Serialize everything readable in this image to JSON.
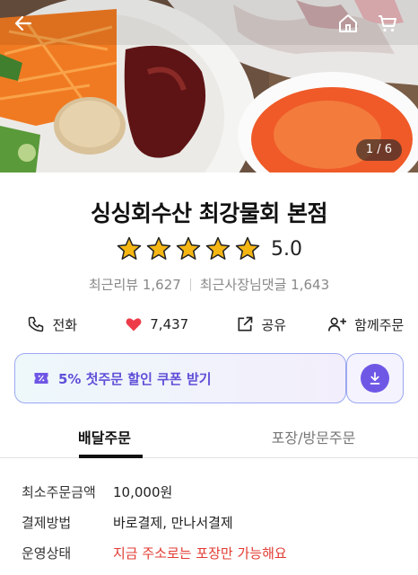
{
  "hero": {
    "counter": "1 / 6",
    "icons": {
      "back": "back-arrow-icon",
      "home": "home-icon",
      "cart": "cart-icon"
    }
  },
  "store": {
    "name": "싱싱회수산 최강물회 본점",
    "rating": 5.0,
    "rating_text": "5.0",
    "stars_filled": 5,
    "recent_reviews": "최근리뷰 1,627",
    "owner_replies": "최근사장님댓글 1,643"
  },
  "actions": [
    {
      "label": "전화",
      "icon": "phone-icon"
    },
    {
      "label": "7,437",
      "icon": "heart-icon"
    },
    {
      "label": "공유",
      "icon": "share-icon"
    },
    {
      "label": "함께주문",
      "icon": "add-person-icon"
    }
  ],
  "coupon": {
    "label": "5% 첫주문 할인 쿠폰 받기",
    "icon": "coupon-ticket-icon",
    "download_icon": "download-icon"
  },
  "tabs": [
    {
      "label": "배달주문",
      "active": true
    },
    {
      "label": "포장/방문주문",
      "active": false
    }
  ],
  "info": {
    "min_order": {
      "label": "최소주문금액",
      "value": "10,000원"
    },
    "payment": {
      "label": "결제방법",
      "value": "바로결제, 만나서결제"
    },
    "status": {
      "label": "운영상태",
      "value": "지금 주소로는 포장만 가능해요"
    }
  },
  "colors": {
    "star": "#f5b614",
    "heart": "#ee3b4a",
    "coupon_accent": "#6f57e6",
    "warning": "#e23b33"
  }
}
